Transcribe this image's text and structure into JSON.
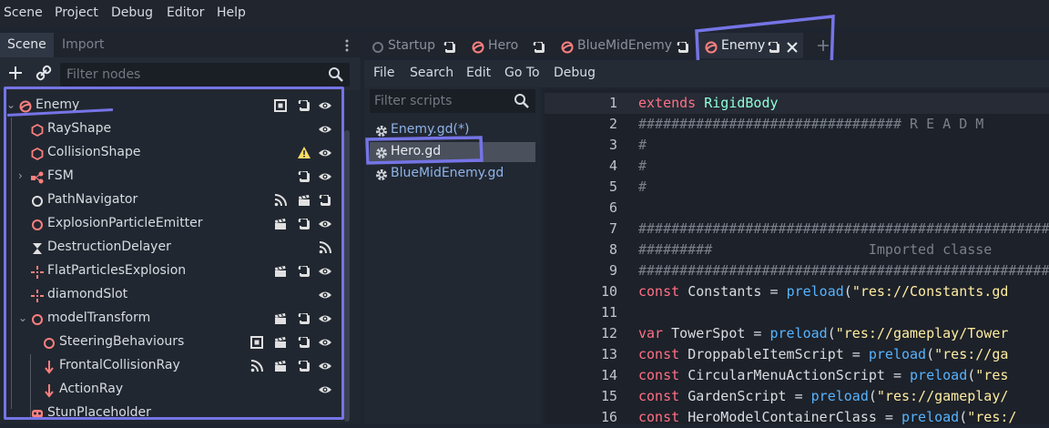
{
  "menubar": {
    "items": [
      "Scene",
      "Project",
      "Debug",
      "Editor",
      "Help"
    ]
  },
  "scene_dock": {
    "tabs": [
      "Scene",
      "Import"
    ],
    "filter_placeholder": "Filter nodes",
    "nodes": [
      {
        "label": "Enemy",
        "depth": 0,
        "expanded": true,
        "icon": "spatial-red-icon",
        "right_icons": [
          "instance-icon",
          "script-icon",
          "eye-icon"
        ]
      },
      {
        "label": "RayShape",
        "depth": 1,
        "icon": "shape-icon",
        "right_icons": [
          "eye-icon"
        ]
      },
      {
        "label": "CollisionShape",
        "depth": 1,
        "icon": "shape-icon",
        "right_icons": [
          "warning-icon",
          "eye-icon"
        ]
      },
      {
        "label": "FSM",
        "depth": 1,
        "collapsed": true,
        "icon": "graph-icon",
        "right_icons": [
          "script-icon",
          "eye-icon"
        ]
      },
      {
        "label": "PathNavigator",
        "depth": 1,
        "icon": "node-white-icon",
        "right_icons": [
          "signal-icon",
          "clapper-icon",
          "script-icon"
        ]
      },
      {
        "label": "ExplosionParticleEmitter",
        "depth": 1,
        "icon": "spatial-icon",
        "right_icons": [
          "clapper-icon",
          "script-icon",
          "eye-icon"
        ]
      },
      {
        "label": "DestructionDelayer",
        "depth": 1,
        "icon": "timer-icon",
        "right_icons": [
          "signal-icon"
        ]
      },
      {
        "label": "FlatParticlesExplosion",
        "depth": 1,
        "icon": "particles-icon",
        "right_icons": [
          "clapper-icon",
          "script-icon",
          "eye-icon"
        ]
      },
      {
        "label": "diamondSlot",
        "depth": 1,
        "icon": "particles-icon",
        "right_icons": [
          "eye-icon"
        ]
      },
      {
        "label": "modelTransform",
        "depth": 1,
        "expanded": true,
        "icon": "spatial-icon",
        "right_icons": [
          "clapper-icon",
          "script-icon",
          "eye-icon"
        ]
      },
      {
        "label": "SteeringBehaviours",
        "depth": 2,
        "icon": "spatial-icon",
        "right_icons": [
          "instance-icon",
          "clapper-icon",
          "script-icon",
          "eye-icon"
        ]
      },
      {
        "label": "FrontalCollisionRay",
        "depth": 2,
        "icon": "raycast-icon",
        "right_icons": [
          "signal-icon",
          "clapper-icon",
          "script-icon",
          "eye-icon"
        ]
      },
      {
        "label": "ActionRay",
        "depth": 2,
        "icon": "raycast-icon",
        "right_icons": [
          "eye-icon"
        ]
      },
      {
        "label": "StunPlaceholder",
        "depth": 1,
        "icon": "skull-icon",
        "right_icons": []
      }
    ]
  },
  "editor_tabs": [
    {
      "label": "Startup",
      "icon": "script-icon"
    },
    {
      "label": "Hero",
      "icon": "scene-icon"
    },
    {
      "label": "BlueMidEnemy",
      "icon": "scene-icon"
    },
    {
      "label": "Enemy",
      "icon": "scene-icon",
      "active": true
    }
  ],
  "script_menu": {
    "items": [
      "File",
      "Search",
      "Edit",
      "Go To",
      "Debug"
    ]
  },
  "script_list": {
    "filter_placeholder": "Filter scripts",
    "items": [
      {
        "label": "Enemy.gd(*)",
        "selected": false
      },
      {
        "label": "Hero.gd",
        "selected": true
      },
      {
        "label": "BlueMidEnemy.gd",
        "selected": false
      }
    ]
  },
  "code": {
    "line_numbers": [
      "1",
      "2",
      "3",
      "4",
      "5",
      "6",
      "7",
      "8",
      "9",
      "10",
      "11",
      "12",
      "13",
      "14",
      "15",
      "16"
    ],
    "lines": [
      [
        [
          "kw",
          "extends "
        ],
        [
          "ty",
          "RigidBody"
        ]
      ],
      [
        [
          "cm",
          "################################ R E A D M"
        ]
      ],
      [
        [
          "cm",
          "#"
        ]
      ],
      [
        [
          "cm",
          "#"
        ]
      ],
      [
        [
          "cm",
          "#"
        ]
      ],
      [],
      [
        [
          "cm",
          "###################################################"
        ]
      ],
      [
        [
          "cm",
          "#########                   Imported classe"
        ]
      ],
      [
        [
          "cm",
          "###################################################"
        ]
      ],
      [
        [
          "kw",
          "const "
        ],
        [
          "tx",
          "Constants = "
        ],
        [
          "fn",
          "preload"
        ],
        [
          "tx",
          "("
        ],
        [
          "st",
          "\"res://Constants.gd"
        ]
      ],
      [],
      [
        [
          "kw",
          "var "
        ],
        [
          "tx",
          "TowerSpot = "
        ],
        [
          "fn",
          "preload"
        ],
        [
          "tx",
          "("
        ],
        [
          "st",
          "\"res://gameplay/Tower"
        ]
      ],
      [
        [
          "kw",
          "const "
        ],
        [
          "tx",
          "DroppableItemScript = "
        ],
        [
          "fn",
          "preload"
        ],
        [
          "tx",
          "("
        ],
        [
          "st",
          "\"res://ga"
        ]
      ],
      [
        [
          "kw",
          "const "
        ],
        [
          "tx",
          "CircularMenuActionScript = "
        ],
        [
          "fn",
          "preload"
        ],
        [
          "tx",
          "("
        ],
        [
          "st",
          "\"res"
        ]
      ],
      [
        [
          "kw",
          "const "
        ],
        [
          "tx",
          "GardenScript = "
        ],
        [
          "fn",
          "preload"
        ],
        [
          "tx",
          "("
        ],
        [
          "st",
          "\"res://gameplay/"
        ]
      ],
      [
        [
          "kw",
          "const "
        ],
        [
          "tx",
          "HeroModelContainerClass = "
        ],
        [
          "fn",
          "preload"
        ],
        [
          "tx",
          "("
        ],
        [
          "st",
          "\"res:/"
        ]
      ]
    ]
  },
  "colors": {
    "accent": "#7574e6",
    "keyword": "#ff7085",
    "type": "#8effda",
    "function": "#57b3ff",
    "string": "#ffeda1",
    "comment": "#7a808a"
  }
}
